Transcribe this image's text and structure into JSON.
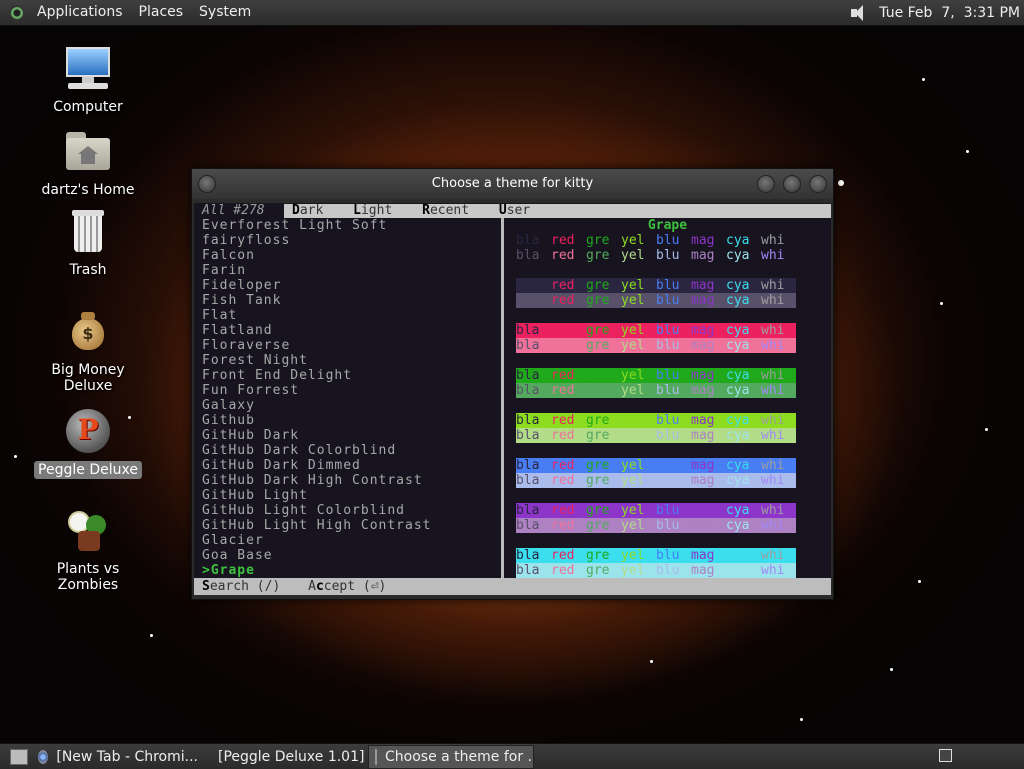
{
  "top_panel": {
    "menus": [
      "Applications",
      "Places",
      "System"
    ],
    "clock": "Tue Feb  7,  3:31 PM"
  },
  "desktop_icons": [
    {
      "label": "Computer",
      "icon": "computer-icon"
    },
    {
      "label": "dartz's Home",
      "icon": "home-folder-icon"
    },
    {
      "label": "Trash",
      "icon": "trash-icon"
    },
    {
      "label": "Big Money Deluxe",
      "icon": "money-bag-icon"
    },
    {
      "label": "Peggle Deluxe",
      "icon": "peggle-icon",
      "selected": true
    },
    {
      "label": "Plants vs Zombies",
      "icon": "plants-vs-zombies-icon"
    }
  ],
  "window": {
    "title": "Choose a theme for kitty",
    "tabs": {
      "all": "All #278",
      "dark_key": "D",
      "dark_rest": "ark",
      "light_key": "L",
      "light_rest": "ight",
      "recent_key": "R",
      "recent_rest": "ecent",
      "user_key": "U",
      "user_rest": "ser"
    },
    "themes": [
      "Everforest Light Soft",
      "fairyfloss",
      "Falcon",
      "Farin",
      "Fideloper",
      "Fish Tank",
      "Flat",
      "Flatland",
      "Floraverse",
      "Forest Night",
      "Front End Delight",
      "Fun Forrest",
      "Galaxy",
      "Github",
      "GitHub Dark",
      "GitHub Dark Colorblind",
      "GitHub Dark Dimmed",
      "GitHub Dark High Contrast",
      "GitHub Light",
      "GitHub Light Colorblind",
      "GitHub Light High Contrast",
      "Glacier",
      "Goa Base"
    ],
    "current_theme": ">Grape",
    "preview_title": "Grape",
    "color_names": [
      "bla",
      "red",
      "gre",
      "yel",
      "blu",
      "mag",
      "cya",
      "whi"
    ],
    "status": {
      "search_key": "S",
      "search_rest": "earch (/)",
      "accept_pre": "A",
      "accept_key": "c",
      "accept_rest": "cept (⏎)"
    },
    "preview_rows": [
      {
        "bg": "#171420",
        "fg": [
          "#2a2540",
          "#ec2160",
          "#1fa91b",
          "#8ddc1f",
          "#487df4",
          "#8d35c9",
          "#3bdeed",
          "#9e9ea0"
        ]
      },
      {
        "bg": "#171420",
        "fg": [
          "#59516a",
          "#f0729a",
          "#53aa5e",
          "#b2dc87",
          "#a9bcec",
          "#ad81c2",
          "#9de3eb",
          "#a288f7"
        ]
      },
      {
        "bg": "#2a2540",
        "fg": [
          "#2a2540",
          "#ec2160",
          "#1fa91b",
          "#8ddc1f",
          "#487df4",
          "#8d35c9",
          "#3bdeed",
          "#9e9ea0"
        ]
      },
      {
        "bg": "#59516a",
        "fg": [
          "#59516a",
          "#ec2160",
          "#1fa91b",
          "#8ddc1f",
          "#487df4",
          "#8d35c9",
          "#3bdeed",
          "#9e9ea0"
        ]
      },
      {
        "bg": "#ec2160",
        "fg": [
          "#2a2540",
          "#ec2160",
          "#1fa91b",
          "#8ddc1f",
          "#487df4",
          "#8d35c9",
          "#3bdeed",
          "#9e9ea0"
        ]
      },
      {
        "bg": "#f0729a",
        "fg": [
          "#59516a",
          "#f0729a",
          "#53aa5e",
          "#b2dc87",
          "#a9bcec",
          "#ad81c2",
          "#9de3eb",
          "#a288f7"
        ]
      },
      {
        "bg": "#1fa91b",
        "fg": [
          "#2a2540",
          "#ec2160",
          "#1fa91b",
          "#8ddc1f",
          "#487df4",
          "#8d35c9",
          "#3bdeed",
          "#9e9ea0"
        ]
      },
      {
        "bg": "#53aa5e",
        "fg": [
          "#59516a",
          "#f0729a",
          "#53aa5e",
          "#b2dc87",
          "#a9bcec",
          "#ad81c2",
          "#9de3eb",
          "#a288f7"
        ]
      },
      {
        "bg": "#8ddc1f",
        "fg": [
          "#2a2540",
          "#ec2160",
          "#1fa91b",
          "#8ddc1f",
          "#487df4",
          "#8d35c9",
          "#3bdeed",
          "#9e9ea0"
        ]
      },
      {
        "bg": "#b2dc87",
        "fg": [
          "#59516a",
          "#f0729a",
          "#53aa5e",
          "#b2dc87",
          "#a9bcec",
          "#ad81c2",
          "#9de3eb",
          "#a288f7"
        ]
      },
      {
        "bg": "#487df4",
        "fg": [
          "#2a2540",
          "#ec2160",
          "#1fa91b",
          "#8ddc1f",
          "#487df4",
          "#8d35c9",
          "#3bdeed",
          "#9e9ea0"
        ]
      },
      {
        "bg": "#a9bcec",
        "fg": [
          "#59516a",
          "#f0729a",
          "#53aa5e",
          "#b2dc87",
          "#a9bcec",
          "#ad81c2",
          "#9de3eb",
          "#a288f7"
        ]
      },
      {
        "bg": "#8d35c9",
        "fg": [
          "#2a2540",
          "#ec2160",
          "#1fa91b",
          "#8ddc1f",
          "#487df4",
          "#8d35c9",
          "#3bdeed",
          "#9e9ea0"
        ]
      },
      {
        "bg": "#ad81c2",
        "fg": [
          "#59516a",
          "#f0729a",
          "#53aa5e",
          "#b2dc87",
          "#a9bcec",
          "#ad81c2",
          "#9de3eb",
          "#a288f7"
        ]
      },
      {
        "bg": "#3bdeed",
        "fg": [
          "#2a2540",
          "#ec2160",
          "#1fa91b",
          "#8ddc1f",
          "#487df4",
          "#8d35c9",
          "#3bdeed",
          "#9e9ea0"
        ]
      },
      {
        "bg": "#9de3eb",
        "fg": [
          "#59516a",
          "#f0729a",
          "#53aa5e",
          "#b2dc87",
          "#a9bcec",
          "#ad81c2",
          "#9de3eb",
          "#a288f7"
        ]
      }
    ]
  },
  "taskbar": {
    "tasks": [
      {
        "label": "[New Tab - Chromi...",
        "icon": "chromium-icon"
      },
      {
        "label": "[Peggle Deluxe 1.01]",
        "icon": "peggle-task-icon"
      },
      {
        "label": "Choose a theme for ...",
        "icon": "terminal-icon",
        "active": true
      }
    ]
  }
}
